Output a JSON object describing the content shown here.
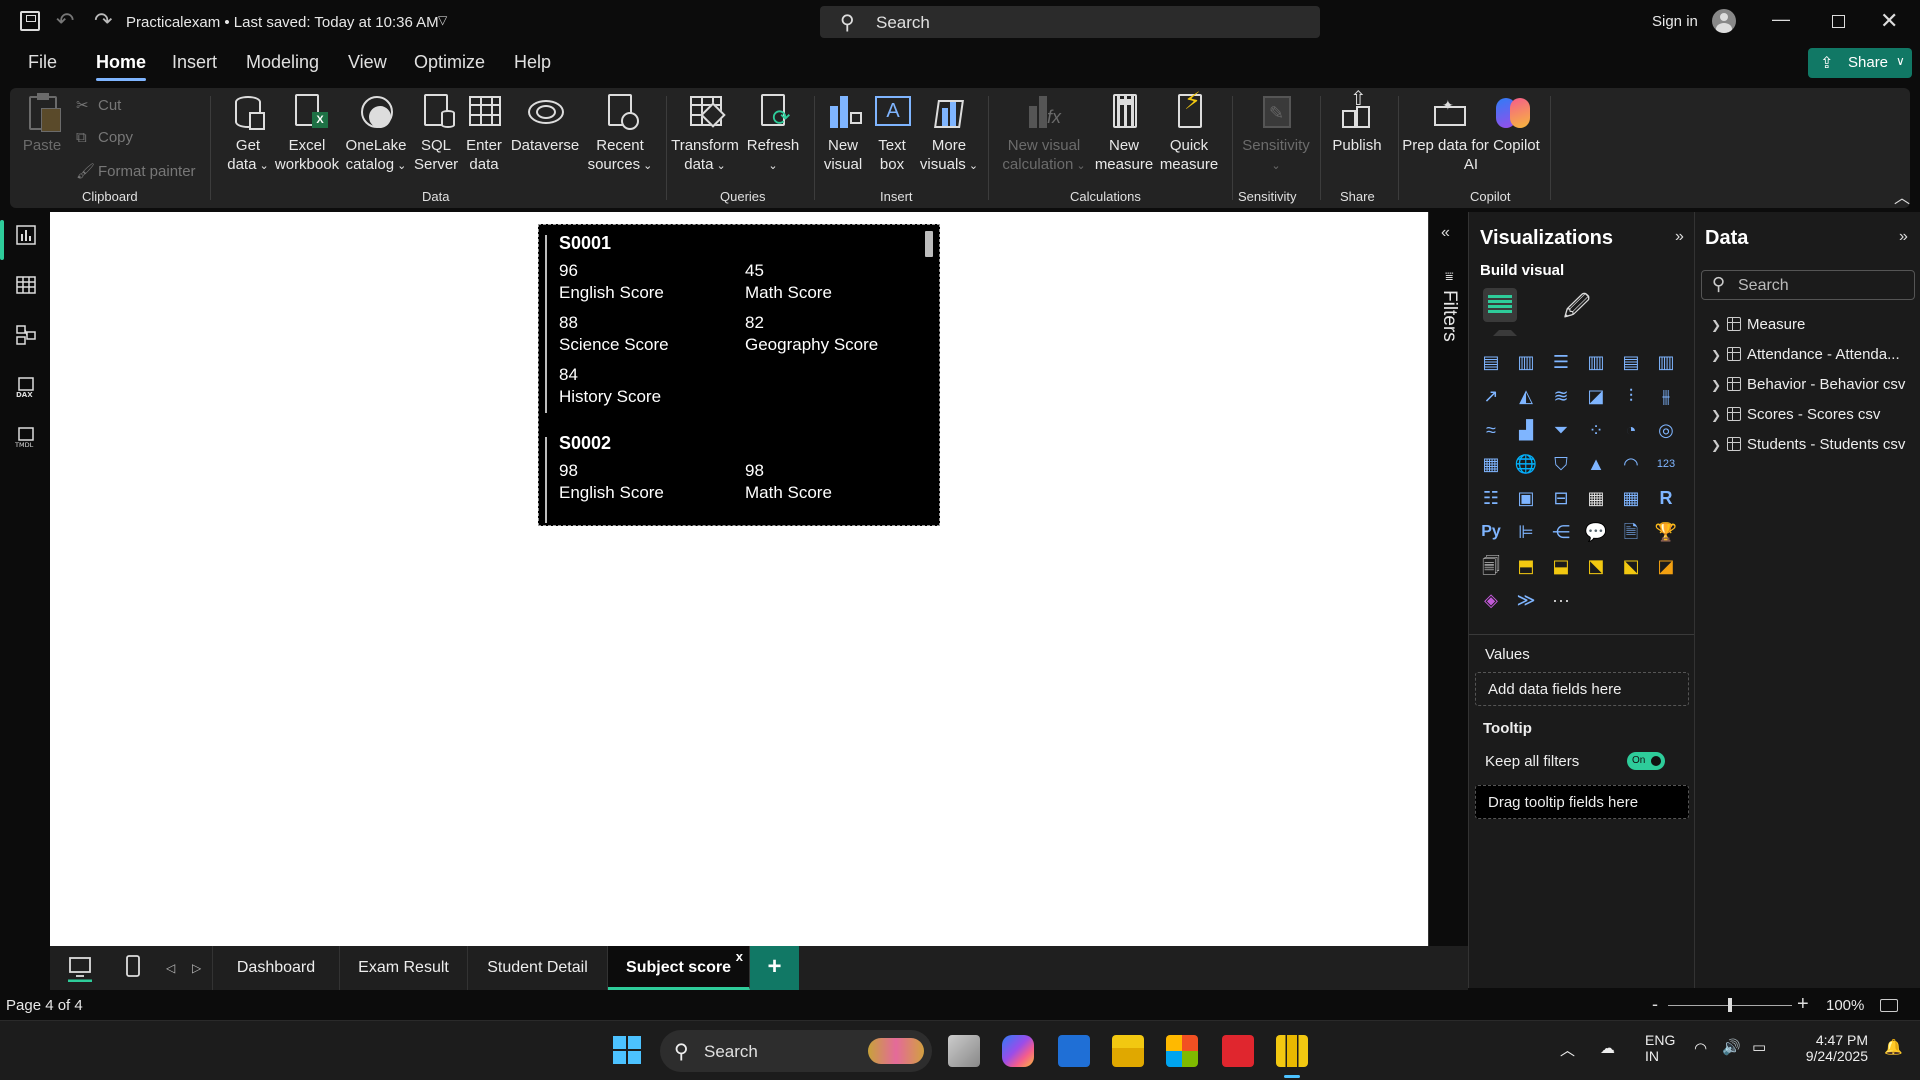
{
  "titlebar": {
    "filename": "Practicalexam",
    "saved": "Last saved: Today at 10:36 AM",
    "search_placeholder": "Search",
    "signin": "Sign in"
  },
  "menu": [
    "File",
    "Home",
    "Insert",
    "Modeling",
    "View",
    "Optimize",
    "Help"
  ],
  "menu_active": "Home",
  "share_label": "Share",
  "ribbon": {
    "clipboard": {
      "paste": "Paste",
      "cut": "Cut",
      "copy": "Copy",
      "format_painter": "Format painter",
      "group": "Clipboard"
    },
    "data": {
      "get_data": [
        "Get",
        "data"
      ],
      "excel": [
        "Excel",
        "workbook"
      ],
      "onelake": [
        "OneLake",
        "catalog"
      ],
      "sql": [
        "SQL",
        "Server"
      ],
      "enter": [
        "Enter",
        "data"
      ],
      "dataverse": "Dataverse",
      "recent": [
        "Recent",
        "sources"
      ],
      "group": "Data"
    },
    "queries": {
      "transform": [
        "Transform",
        "data"
      ],
      "refresh": "Refresh",
      "group": "Queries"
    },
    "insert": {
      "new_visual": [
        "New",
        "visual"
      ],
      "text_box": [
        "Text",
        "box"
      ],
      "more_visuals": [
        "More",
        "visuals"
      ],
      "group": "Insert"
    },
    "calculations": {
      "new_visual_calc": [
        "New visual",
        "calculation"
      ],
      "new_measure": [
        "New",
        "measure"
      ],
      "quick_measure": [
        "Quick",
        "measure"
      ],
      "group": "Calculations"
    },
    "sensitivity": {
      "label": "Sensitivity",
      "group": "Sensitivity"
    },
    "share": {
      "publish": "Publish",
      "group": "Share"
    },
    "copilot": {
      "prep": [
        "Prep data for Copilot",
        "AI"
      ],
      "group": "Copilot"
    }
  },
  "visual": {
    "cards": [
      {
        "id": "S0001",
        "items": [
          {
            "value": "96",
            "label": "English Score"
          },
          {
            "value": "45",
            "label": "Math Score"
          },
          {
            "value": "88",
            "label": "Science Score"
          },
          {
            "value": "82",
            "label": "Geography Score"
          },
          {
            "value": "84",
            "label": "History Score"
          }
        ]
      },
      {
        "id": "S0002",
        "items": [
          {
            "value": "98",
            "label": "English Score"
          },
          {
            "value": "98",
            "label": "Math Score"
          }
        ]
      }
    ]
  },
  "filters_label": "Filters",
  "viz_pane": {
    "title": "Visualizations",
    "build_visual": "Build visual",
    "values_title": "Values",
    "values_placeholder": "Add data fields here",
    "tooltip_title": "Tooltip",
    "keep_filters": "Keep all filters",
    "toggle_label": "On",
    "tooltip_placeholder": "Drag tooltip fields here"
  },
  "data_pane": {
    "title": "Data",
    "search_placeholder": "Search",
    "tables": [
      "Measure",
      "Attendance - Attenda...",
      "Behavior - Behavior csv",
      "Scores - Scores csv",
      "Students - Students csv"
    ]
  },
  "pages": [
    "Dashboard",
    "Exam Result",
    "Student Detail",
    "Subject score"
  ],
  "active_page": "Subject score",
  "status": {
    "page": "Page 4 of 4",
    "zoom": "100%",
    "zoom_level": 0.5
  },
  "taskbar": {
    "search": "Search",
    "lang1": "ENG",
    "lang2": "IN",
    "time": "4:47 PM",
    "date": "9/24/2025"
  },
  "colors": {
    "accent": "#2ecc9a",
    "share_bg": "#117865",
    "viz_icon": "#7fb5ff"
  }
}
